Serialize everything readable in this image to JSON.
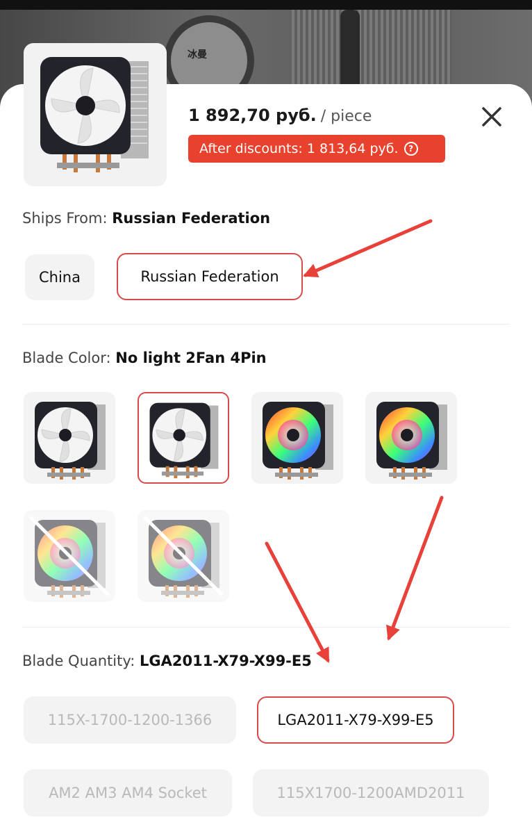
{
  "backdrop": {
    "brand_text": "冰曼 SNOWMAN"
  },
  "product": {
    "price": "1 892,70 руб.",
    "unit": "/ piece",
    "discount_text": "After discounts: 1 813,64 руб."
  },
  "ships_from": {
    "label": "Ships From:",
    "value": "Russian Federation",
    "options": [
      "China",
      "Russian Federation"
    ],
    "selected_index": 1
  },
  "blade_color": {
    "label": "Blade Color:",
    "value": "No light 2Fan 4Pin",
    "swatches": [
      {
        "style": "white-fan",
        "state": "available"
      },
      {
        "style": "white-fan",
        "state": "selected"
      },
      {
        "style": "rgb-fan",
        "state": "available"
      },
      {
        "style": "rgb-fan",
        "state": "available"
      },
      {
        "style": "rgb-fan",
        "state": "unavailable"
      },
      {
        "style": "rgb-fan",
        "state": "unavailable"
      }
    ]
  },
  "blade_quantity": {
    "label": "Blade Quantity:",
    "value": "LGA2011-X79-X99-E5",
    "options": [
      "115X-1700-1200-1366",
      "LGA2011-X79-X99-E5",
      "AM2 AM3 AM4 Socket",
      "115X1700-1200AMD2011"
    ],
    "selected_index": 1,
    "unavailable_indices": [
      0,
      2,
      3
    ]
  },
  "colors": {
    "accent": "#e8412d",
    "selected_border": "#d94a4a",
    "arrow": "#e8413a"
  },
  "icons": {
    "close": "close-icon",
    "help": "help-circle-icon"
  }
}
